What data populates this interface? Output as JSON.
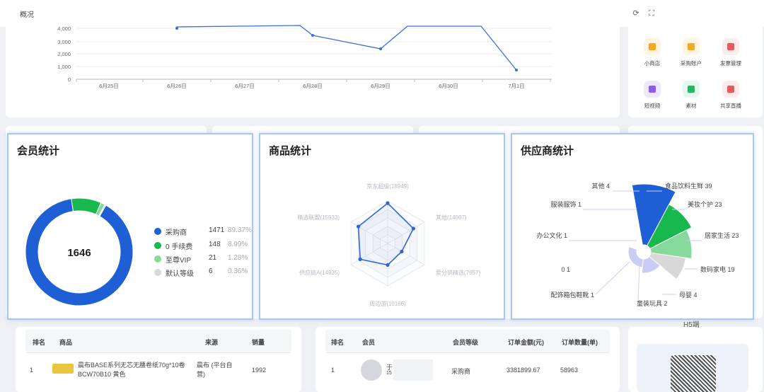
{
  "topbar": {
    "title": "概况",
    "refresh_icon": "refresh-icon",
    "fullscreen_icon": "fullscreen-icon"
  },
  "trend": {
    "yticks": [
      "4,000",
      "3,000",
      "2,000",
      "1,000",
      "0"
    ],
    "xticks": [
      "6月25日",
      "6月26日",
      "6月27日",
      "6月28日",
      "6月29日",
      "6月30日",
      "7月1日"
    ],
    "line_color": "#3a6fd8"
  },
  "quick_links": [
    {
      "label": "小商店",
      "icon": "store-icon",
      "color": "#f5a623",
      "bg": "#fff4e0"
    },
    {
      "label": "采购账户",
      "icon": "wallet-icon",
      "color": "#f5a623",
      "bg": "#fff4e0"
    },
    {
      "label": "发票管理",
      "icon": "invoice-icon",
      "color": "#e85a5a",
      "bg": "#fdeaea"
    },
    {
      "label": "短视频",
      "icon": "video-icon",
      "color": "#8a5cf0",
      "bg": "#efe8fd"
    },
    {
      "label": "素材",
      "icon": "material-icon",
      "color": "#1fb866",
      "bg": "#e4f7ec"
    },
    {
      "label": "共享直播",
      "icon": "live-icon",
      "color": "#e85a5a",
      "bg": "#fdeaea"
    }
  ],
  "members": {
    "title": "会员统计",
    "total": "1646",
    "legend": [
      {
        "name": "采购商",
        "value": "1471",
        "pct": "89.37%",
        "color": "#1e5fd6"
      },
      {
        "name": "0 手续费",
        "value": "148",
        "pct": "8.99%",
        "color": "#18b84e"
      },
      {
        "name": "至尊VIP",
        "value": "21",
        "pct": "1.28%",
        "color": "#86d99b"
      },
      {
        "name": "默认等级",
        "value": "6",
        "pct": "0.36%",
        "color": "#d8d8d8"
      }
    ]
  },
  "products": {
    "title": "商品统计",
    "indicators": [
      "京东超级(18949)",
      "其他(14007)",
      "爱分销精选(7657)",
      "周边游(10166)",
      "供应链A(14935)",
      "精选联盟(15933)"
    ]
  },
  "suppliers": {
    "title": "供应商统计",
    "labels": [
      "其他 4",
      "食品饮料生鲜 39",
      "服装服饰 1",
      "美妆个护 23",
      "办公文化 1",
      "居家生活 23",
      "0 1",
      "数码家电 19",
      "配饰箱包鞋靴 1",
      "母婴 4",
      "童装玩具 2"
    ]
  },
  "table_left": {
    "headers": [
      "排名",
      "商品",
      "来源",
      "销量"
    ],
    "rows": [
      {
        "rank": "1",
        "product": "晨布BASE系列无芯无腰卷纸70g*10卷 BCW70B10 黄色",
        "source": "晨布 (平台自营)",
        "sales": "1992"
      }
    ]
  },
  "table_right": {
    "headers": [
      "排名",
      "会员",
      "会员等级",
      "订单金额(元)",
      "订单数量(单)"
    ],
    "rows": [
      {
        "rank": "1",
        "member_id": "15",
        "member_initial": "于",
        "level": "采购商",
        "amount": "3381899.67",
        "count": "58963"
      }
    ]
  },
  "side_bottom": {
    "label": "H5端"
  }
}
